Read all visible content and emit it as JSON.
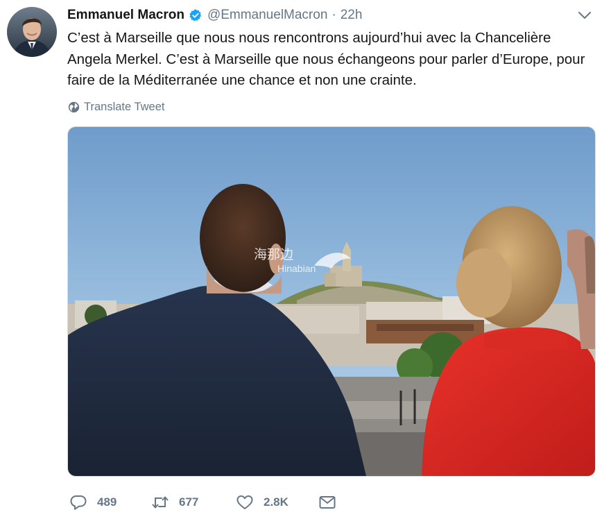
{
  "author": {
    "name": "Emmanuel Macron",
    "handle": "@EmmanuelMacron",
    "separator": "·",
    "time": "22h",
    "verified": true
  },
  "tweet": {
    "lines": [
      "C’est à Marseille que nous nous rencontrons aujourd’hui avec la Chancelière",
      "Angela Merkel. C’est à Marseille que nous échangeons pour parler d’Europe, pour",
      "faire de la Méditerranée une chance et non une crainte."
    ]
  },
  "translate": {
    "label": "Translate Tweet",
    "icon": "globe-icon"
  },
  "media": {
    "watermark_cn": "海那边",
    "watermark_en": "Hinabian"
  },
  "actions": {
    "reply": {
      "count": "489",
      "icon": "reply-icon"
    },
    "retweet": {
      "count": "677",
      "icon": "retweet-icon"
    },
    "like": {
      "count": "2.8K",
      "icon": "heart-icon"
    },
    "dm": {
      "icon": "envelope-icon"
    }
  },
  "colors": {
    "text": "#14171a",
    "secondary": "#657786",
    "verified": "#1da1f2",
    "border": "#d7dde2"
  }
}
